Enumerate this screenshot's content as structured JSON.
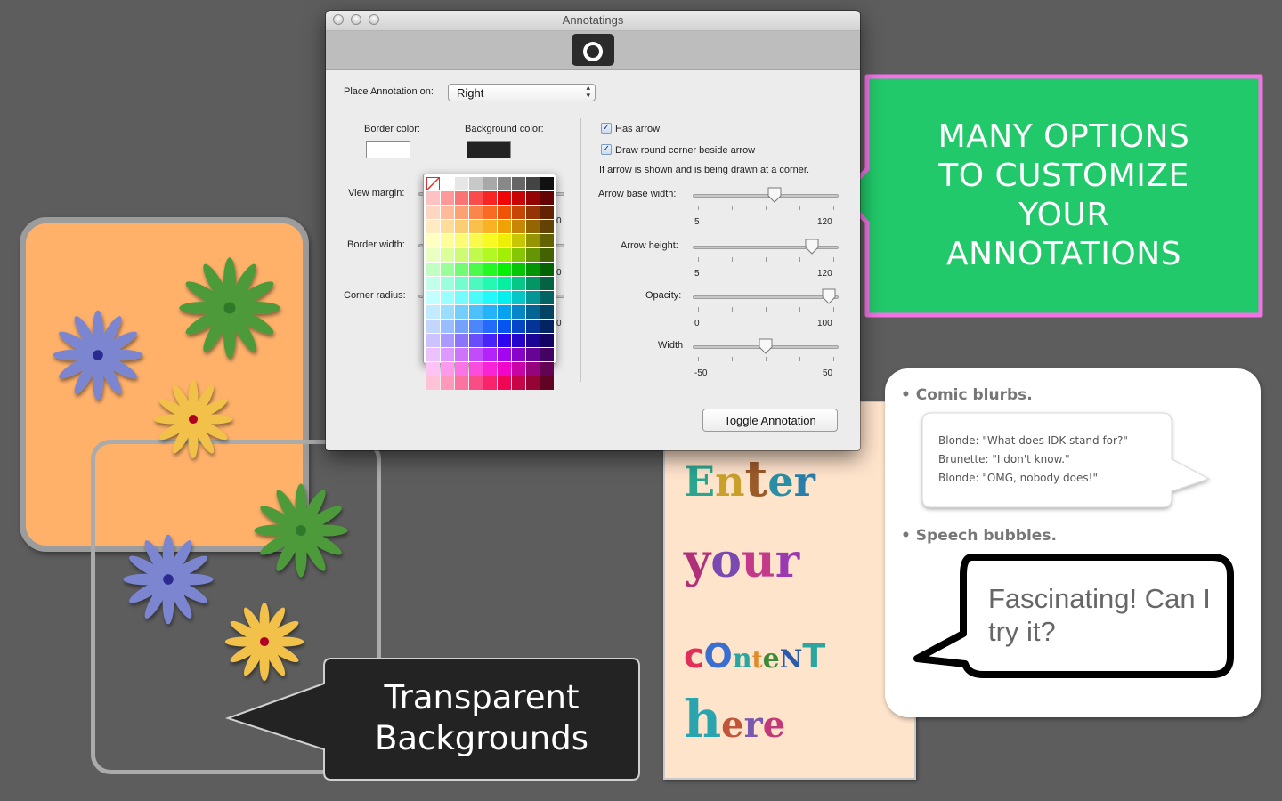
{
  "window": {
    "title": "Annotatings",
    "place_label": "Place Annotation on:",
    "place_value": "Right",
    "border_color_label": "Border color:",
    "background_color_label": "Background color:",
    "border_color": "#ffffff",
    "background_color": "#222222",
    "view_margin_label": "View margin:",
    "border_width_label": "Border width:",
    "corner_radius_label": "Corner radius:",
    "hidden_slider_max_1": "0",
    "hidden_slider_max_2": "0",
    "hidden_slider_max_3": "0",
    "has_arrow_label": "Has arrow",
    "has_arrow_checked": true,
    "round_corner_label": "Draw round corner beside arrow",
    "round_corner_checked": true,
    "corner_hint": "If arrow is shown and is being drawn at a corner.",
    "arrow_base_width": {
      "label": "Arrow base width:",
      "min": "5",
      "max": "120",
      "value": 70
    },
    "arrow_height": {
      "label": "Arrow height:",
      "min": "5",
      "max": "120",
      "value": 102
    },
    "opacity": {
      "label": "Opacity:",
      "min": "0",
      "max": "100",
      "value": 97
    },
    "width": {
      "label": "Width",
      "min": "-50",
      "max": "50",
      "value": 0
    },
    "toggle_button": "Toggle Annotation"
  },
  "callouts": {
    "green_text": [
      "MANY OPTIONS",
      "TO CUSTOMIZE",
      "YOUR",
      "ANNOTATIONS"
    ],
    "green_color": "#22c96a",
    "green_border": "#f472e6",
    "transparent_text": [
      "Transparent",
      "Backgrounds"
    ]
  },
  "content_card": {
    "words": [
      "Enter",
      "your",
      "content",
      "here"
    ],
    "display": [
      "Enter",
      "your",
      "cOntent",
      "here"
    ]
  },
  "comic": {
    "comic_heading": "• Comic blurbs.",
    "comic_lines": [
      "Blonde: \"What does IDK stand for?\"",
      "Brunette: \"I don't know.\"",
      "Blonde: \"OMG, nobody does!\""
    ],
    "speech_heading": "• Speech bubbles.",
    "speech_text": "Fascinating! Can I try it?"
  }
}
